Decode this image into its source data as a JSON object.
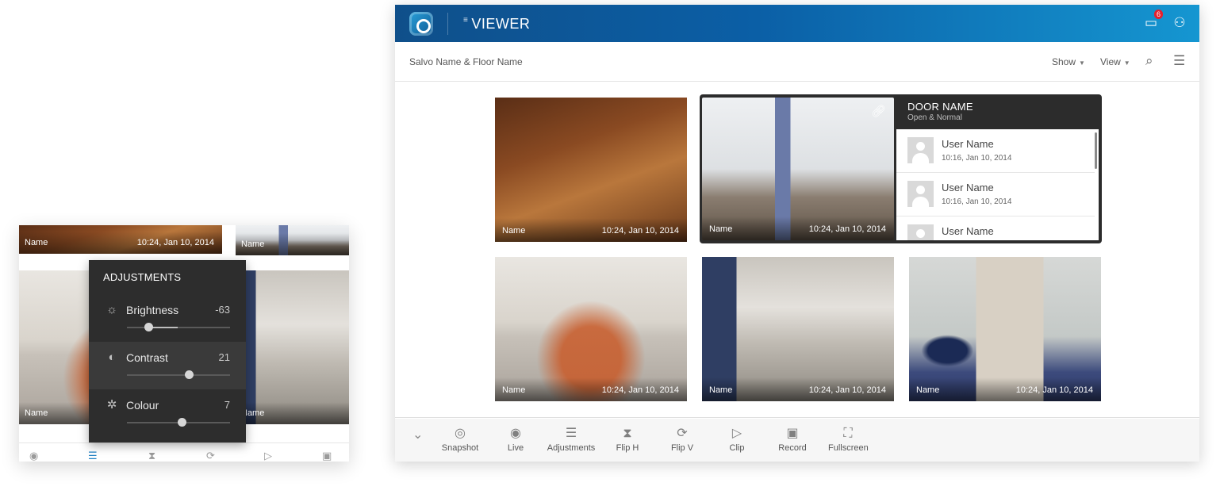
{
  "mini_panel": {
    "tiles": [
      {
        "name": "Name",
        "time": "10:24, Jan 10, 2014"
      },
      {
        "name": "Name",
        "time": ""
      },
      {
        "name": "Name",
        "time": ""
      },
      {
        "name": "Name",
        "time": ""
      }
    ],
    "bottom_icons": [
      "eye-icon",
      "adjustments-icon",
      "flip-h-icon",
      "flip-v-icon",
      "clip-icon",
      "record-icon"
    ]
  },
  "adjustments": {
    "title": "ADJUSTMENTS",
    "rows": [
      {
        "icon": "brightness-icon",
        "label": "Brightness",
        "value": "-63",
        "level": 0.21
      },
      {
        "icon": "contrast-icon",
        "label": "Contrast",
        "value": "21",
        "level": 0.6
      },
      {
        "icon": "colour-icon",
        "label": "Colour",
        "value": "7",
        "level": 0.53
      }
    ]
  },
  "app": {
    "title": "VIEWER",
    "notification_count": "6",
    "icons": [
      "chat-icon",
      "user-icon"
    ]
  },
  "toolbar": {
    "breadcrumb": "Salvo Name & Floor Name",
    "show_label": "Show",
    "view_label": "View",
    "icons": [
      "search-icon",
      "list-view-icon"
    ]
  },
  "cameras": [
    {
      "name": "Name",
      "time": "10:24, Jan 10, 2014"
    },
    {
      "name": "Name",
      "time": "10:24, Jan 10, 2014"
    },
    {
      "name": "Name",
      "time": "10:24, Jan 10, 2014"
    },
    {
      "name": "Name",
      "time": "10:24, Jan 10, 2014"
    },
    {
      "name": "Name",
      "time": "10:24, Jan 10, 2014"
    }
  ],
  "door": {
    "title": "DOOR NAME",
    "status": "Open & Normal",
    "events": [
      {
        "user": "User Name",
        "time": "10:16, Jan 10, 2014"
      },
      {
        "user": "User Name",
        "time": "10:16, Jan 10, 2014"
      },
      {
        "user": "User Name",
        "time": ""
      }
    ]
  },
  "actions": [
    {
      "label": "Snapshot",
      "icon": "snapshot-icon"
    },
    {
      "label": "Live",
      "icon": "eye-icon"
    },
    {
      "label": "Adjustments",
      "icon": "adjustments-icon"
    },
    {
      "label": "Flip H",
      "icon": "flip-h-icon"
    },
    {
      "label": "Flip V",
      "icon": "flip-v-icon"
    },
    {
      "label": "Clip",
      "icon": "clip-icon"
    },
    {
      "label": "Record",
      "icon": "record-icon"
    },
    {
      "label": "Fullscreen",
      "icon": "fullscreen-icon"
    }
  ]
}
